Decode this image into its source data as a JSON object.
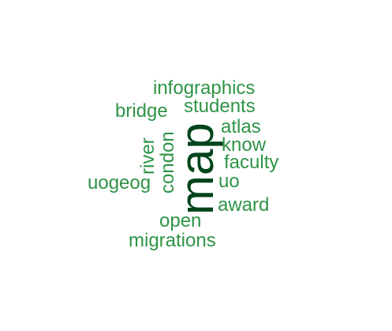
{
  "colors": {
    "primary_word": "#00441b",
    "word": "#2e9447"
  },
  "words": {
    "infographics": "infographics",
    "students": "students",
    "bridge": "bridge",
    "atlas": "atlas",
    "know": "know",
    "faculty": "faculty",
    "uo": "uo",
    "uogeog": "uogeog",
    "award": "award",
    "open": "open",
    "migrations": "migrations",
    "river": "river",
    "condon": "condon",
    "map": "map"
  }
}
